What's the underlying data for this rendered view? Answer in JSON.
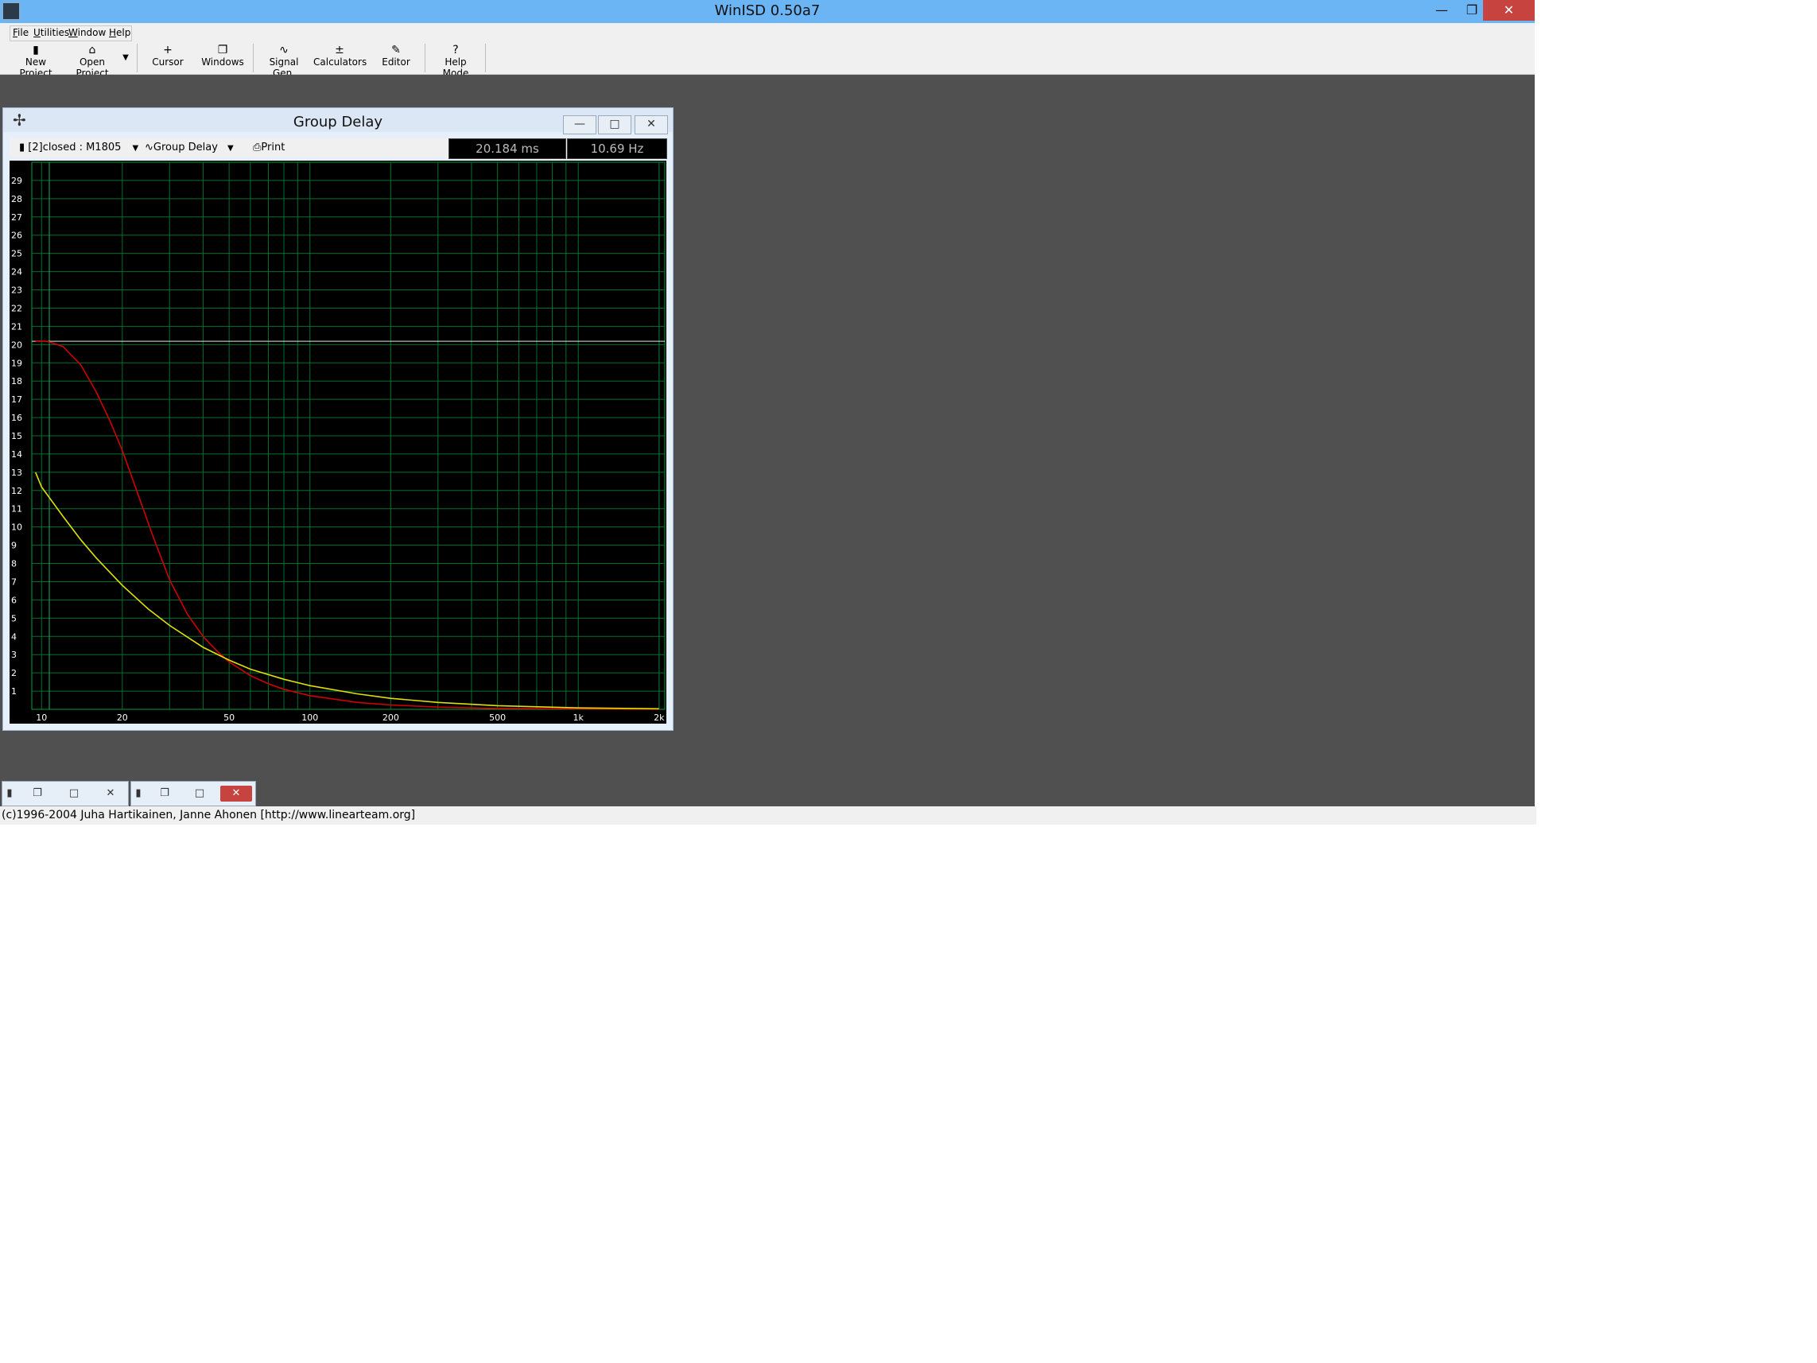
{
  "app": {
    "title": "WinISD 0.50a7"
  },
  "window_controls": {
    "minimize": "—",
    "restore": "❐",
    "close": "✕"
  },
  "menu": [
    {
      "first": "F",
      "rest": "ile"
    },
    {
      "first": "U",
      "rest": "tilities"
    },
    {
      "first": "W",
      "rest": "indow"
    },
    {
      "first": "H",
      "rest": "elp"
    }
  ],
  "toolbar": [
    {
      "label": "New Project",
      "icon": "▮",
      "icon_name": "new-project-icon"
    },
    {
      "label": "Open Project",
      "icon": "⌂",
      "icon_name": "open-folder-icon"
    },
    {
      "label": "Cursor",
      "icon": "+",
      "icon_name": "cursor-icon"
    },
    {
      "label": "Windows",
      "icon": "❐",
      "icon_name": "windows-icon"
    },
    {
      "label": "Signal Gen.",
      "icon": "∿",
      "icon_name": "sine-wave-icon"
    },
    {
      "label": "Calculators",
      "icon": "±",
      "icon_name": "calculator-icon"
    },
    {
      "label": "Editor",
      "icon": "✎",
      "icon_name": "editor-icon"
    },
    {
      "label": "Help Mode",
      "icon": "?",
      "icon_name": "help-icon"
    }
  ],
  "graph_window": {
    "title": "Group Delay",
    "project_select": "[2]closed : M1805",
    "graph_select": "Group Delay",
    "print_label": "Print",
    "readout_value": "20.184 ms",
    "readout_freq": "10.69 Hz",
    "controls": {
      "minimize": "—",
      "maximize": "□",
      "close": "✕"
    }
  },
  "chart_data": {
    "type": "line",
    "title": "",
    "xlabel": "",
    "ylabel": "",
    "x_scale": "log",
    "xlim": [
      9.2,
      2100
    ],
    "ylim": [
      0,
      30
    ],
    "x_ticks": [
      {
        "v": 10,
        "label": "10"
      },
      {
        "v": 20,
        "label": "20"
      },
      {
        "v": 50,
        "label": "50"
      },
      {
        "v": 100,
        "label": "100"
      },
      {
        "v": 200,
        "label": "200"
      },
      {
        "v": 500,
        "label": "500"
      },
      {
        "v": 1000,
        "label": "1k"
      },
      {
        "v": 2000,
        "label": "2k"
      }
    ],
    "y_ticks": [
      "1",
      "2",
      "3",
      "4",
      "5",
      "6",
      "7",
      "8",
      "9",
      "10",
      "11",
      "12",
      "13",
      "14",
      "15",
      "16",
      "17",
      "18",
      "19",
      "20",
      "21",
      "22",
      "23",
      "24",
      "25",
      "26",
      "27",
      "28",
      "29"
    ],
    "cursor": {
      "x": 10.69,
      "y": 20.184
    },
    "grid": true,
    "series": [
      {
        "color": "#d00000",
        "x": [
          9.5,
          10.5,
          12,
          14,
          16,
          18,
          20,
          23,
          26,
          30,
          35,
          40,
          45,
          50,
          60,
          70,
          80,
          100,
          150,
          200,
          300,
          500,
          1000,
          2000
        ],
        "y": [
          20.2,
          20.18,
          19.9,
          18.9,
          17.4,
          15.8,
          14.2,
          11.7,
          9.5,
          7.1,
          5.2,
          4.0,
          3.2,
          2.6,
          1.85,
          1.4,
          1.1,
          0.75,
          0.38,
          0.24,
          0.12,
          0.05,
          0.02,
          0.01
        ]
      },
      {
        "color": "#e0e000",
        "x": [
          9.5,
          10,
          12,
          14,
          16,
          20,
          25,
          30,
          40,
          50,
          60,
          80,
          100,
          150,
          200,
          300,
          500,
          1000,
          2000
        ],
        "y": [
          13.0,
          12.2,
          10.6,
          9.3,
          8.3,
          6.8,
          5.5,
          4.6,
          3.4,
          2.7,
          2.2,
          1.65,
          1.3,
          0.85,
          0.6,
          0.38,
          0.2,
          0.08,
          0.03
        ]
      }
    ]
  },
  "statusbar": {
    "text": "(c)1996-2004 Juha Hartikainen, Janne Ahonen [http://www.linearteam.org]"
  }
}
